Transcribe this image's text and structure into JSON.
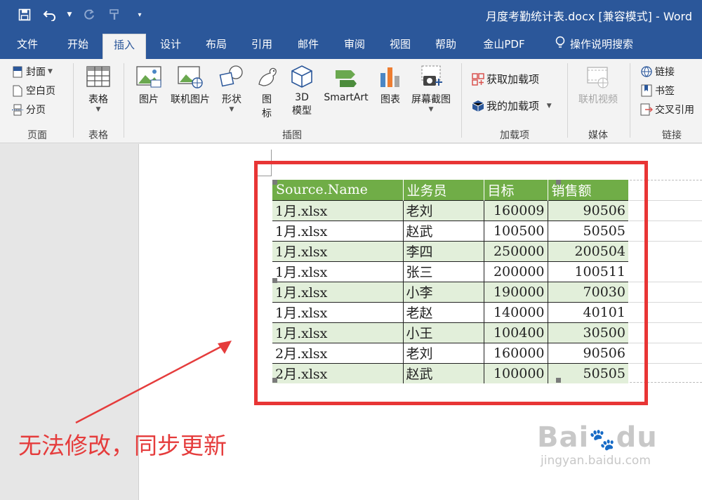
{
  "window": {
    "title": "月度考勤统计表.docx [兼容模式] - Word"
  },
  "qat": {
    "save_icon": "save-icon",
    "undo_icon": "undo-icon",
    "redo_icon": "redo-icon",
    "format_painter_icon": "format-painter-icon",
    "customize_icon": "customize-qat-icon"
  },
  "tabs": [
    {
      "label": "文件"
    },
    {
      "label": "开始"
    },
    {
      "label": "插入"
    },
    {
      "label": "设计"
    },
    {
      "label": "布局"
    },
    {
      "label": "引用"
    },
    {
      "label": "邮件"
    },
    {
      "label": "审阅"
    },
    {
      "label": "视图"
    },
    {
      "label": "帮助"
    },
    {
      "label": "金山PDF"
    },
    {
      "label": "操作说明搜索"
    }
  ],
  "active_tab": "插入",
  "ribbon": {
    "pages": {
      "cover": "封面",
      "blank": "空白页",
      "break": "分页",
      "label": "页面"
    },
    "tables": {
      "table": "表格",
      "label": "表格"
    },
    "illustrations": {
      "picture": "图片",
      "online_picture": "联机图片",
      "shapes": "形状",
      "icons_top": "图",
      "icons_bottom": "标",
      "model_top": "3D",
      "model_bottom": "模型",
      "smartart": "SmartArt",
      "chart": "图表",
      "screenshot": "屏幕截图",
      "label": "插图"
    },
    "addins": {
      "get": "获取加载项",
      "mine": "我的加载项",
      "label": "加载项"
    },
    "media": {
      "online_video": "联机视频",
      "label": "媒体"
    },
    "links": {
      "link": "链接",
      "bookmark": "书签",
      "crossref": "交叉引用",
      "label": "链接"
    }
  },
  "table": {
    "headers": [
      "Source.Name",
      "业务员",
      "目标",
      "销售额"
    ],
    "rows": [
      [
        "1月.xlsx",
        "老刘",
        "160009",
        "90506"
      ],
      [
        "1月.xlsx",
        "赵武",
        "100500",
        "50505"
      ],
      [
        "1月.xlsx",
        "李四",
        "250000",
        "200504"
      ],
      [
        "1月.xlsx",
        "张三",
        "200000",
        "100511"
      ],
      [
        "1月.xlsx",
        "小李",
        "190000",
        "70030"
      ],
      [
        "1月.xlsx",
        "老赵",
        "140000",
        "40101"
      ],
      [
        "1月.xlsx",
        "小王",
        "100400",
        "30500"
      ],
      [
        "2月.xlsx",
        "老刘",
        "160000",
        "90506"
      ],
      [
        "2月.xlsx",
        "赵武",
        "100000",
        "50505"
      ]
    ]
  },
  "annotation": "无法修改，同步更新",
  "colors": {
    "title_bar": "#2b579a",
    "header_fill": "#70ad47",
    "band_fill": "#e2efda",
    "annotation": "#e53c3c"
  }
}
